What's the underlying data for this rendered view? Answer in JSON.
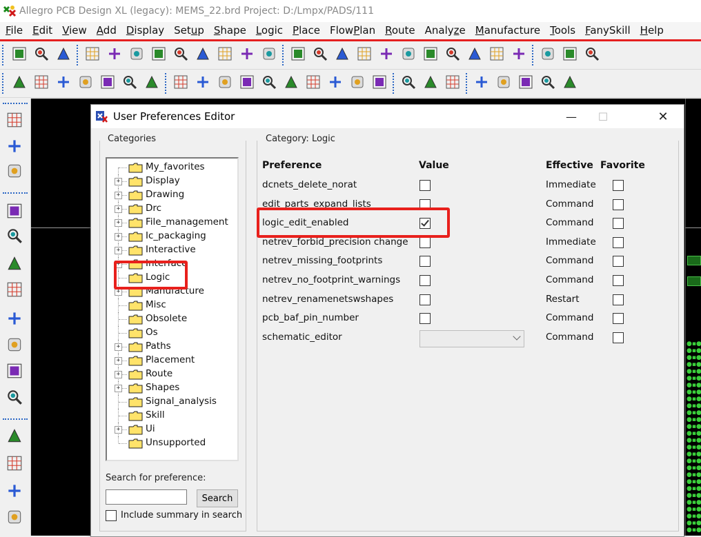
{
  "window": {
    "title": "Allegro PCB Design XL (legacy): MEMS_22.brd  Project: D:/Lmpx/PADS/111"
  },
  "menu": [
    {
      "label": "File",
      "ul": "F",
      "rest": "ile"
    },
    {
      "label": "Edit",
      "ul": "E",
      "rest": "dit"
    },
    {
      "label": "View",
      "ul": "V",
      "rest": "iew"
    },
    {
      "label": "Add",
      "ul": "A",
      "rest": "dd"
    },
    {
      "label": "Display",
      "ul": "D",
      "rest": "isplay"
    },
    {
      "label": "Setup",
      "pre": "Set",
      "ul": "u",
      "rest": "p"
    },
    {
      "label": "Shape",
      "ul": "S",
      "rest": "hape"
    },
    {
      "label": "Logic",
      "ul": "L",
      "rest": "ogic"
    },
    {
      "label": "Place",
      "ul": "P",
      "rest": "lace"
    },
    {
      "label": "FlowPlan",
      "pre": "Flow",
      "ul": "P",
      "rest": "lan"
    },
    {
      "label": "Route",
      "ul": "R",
      "rest": "oute"
    },
    {
      "label": "Analyze",
      "pre": "Analy",
      "ul": "z",
      "rest": "e"
    },
    {
      "label": "Manufacture",
      "ul": "M",
      "rest": "anufacture"
    },
    {
      "label": "Tools",
      "ul": "T",
      "rest": "ools"
    },
    {
      "label": "FanySkill",
      "ul": "F",
      "rest": "anySkill"
    },
    {
      "label": "Help",
      "ul": "H",
      "rest": "elp"
    }
  ],
  "dialog": {
    "title": "User Preferences Editor",
    "categories_label": "Categories",
    "category_label": "Category:  Logic",
    "search_label": "Search for preference:",
    "search_value": "",
    "search_button": "Search",
    "include_summary_label": "Include summary in search",
    "include_summary_checked": false,
    "tree": [
      {
        "label": "My_favorites",
        "expandable": false
      },
      {
        "label": "Display",
        "expandable": true
      },
      {
        "label": "Drawing",
        "expandable": true
      },
      {
        "label": "Drc",
        "expandable": true
      },
      {
        "label": "File_management",
        "expandable": true
      },
      {
        "label": "Ic_packaging",
        "expandable": true
      },
      {
        "label": "Interactive",
        "expandable": true
      },
      {
        "label": "Interface",
        "expandable": true
      },
      {
        "label": "Logic",
        "expandable": false,
        "selected": true
      },
      {
        "label": "Manufacture",
        "expandable": true
      },
      {
        "label": "Misc",
        "expandable": false
      },
      {
        "label": "Obsolete",
        "expandable": false
      },
      {
        "label": "Os",
        "expandable": false
      },
      {
        "label": "Paths",
        "expandable": true
      },
      {
        "label": "Placement",
        "expandable": true
      },
      {
        "label": "Route",
        "expandable": true
      },
      {
        "label": "Shapes",
        "expandable": true
      },
      {
        "label": "Signal_analysis",
        "expandable": false
      },
      {
        "label": "Skill",
        "expandable": false
      },
      {
        "label": "Ui",
        "expandable": true
      },
      {
        "label": "Unsupported",
        "expandable": false
      }
    ],
    "columns": {
      "preference": "Preference",
      "value": "Value",
      "effective": "Effective",
      "favorite": "Favorite"
    },
    "preferences": [
      {
        "name": "dcnets_delete_norat",
        "type": "check",
        "checked": false,
        "effective": "Immediate",
        "favorite": false
      },
      {
        "name": "edit_parts_expand_lists",
        "type": "check",
        "checked": false,
        "effective": "Command",
        "favorite": false
      },
      {
        "name": "logic_edit_enabled",
        "type": "check",
        "checked": true,
        "effective": "Command",
        "favorite": false
      },
      {
        "name": "netrev_forbid_precision change",
        "type": "check",
        "checked": false,
        "effective": "Immediate",
        "favorite": false
      },
      {
        "name": "netrev_missing_footprints",
        "type": "check",
        "checked": false,
        "effective": "Command",
        "favorite": false
      },
      {
        "name": "netrev_no_footprint_warnings",
        "type": "check",
        "checked": false,
        "effective": "Command",
        "favorite": false
      },
      {
        "name": "netrev_renamenetswshapes",
        "type": "check",
        "checked": false,
        "effective": "Restart",
        "favorite": false
      },
      {
        "name": "pcb_baf_pin_number",
        "type": "check",
        "checked": false,
        "effective": "Command",
        "favorite": false
      },
      {
        "name": "schematic_editor",
        "type": "select",
        "value": "",
        "effective": "Command",
        "favorite": false
      }
    ]
  },
  "toolbar1_icons": [
    "new-file",
    "open-folder",
    "save",
    "move",
    "copy",
    "delete",
    "undo",
    "undo-down",
    "redo",
    "redo-down",
    "green-blob",
    "pin",
    "grid-snap",
    "grid-select",
    "zoom-fit",
    "zoom-area",
    "zoom-in",
    "zoom-out",
    "zoom-prev",
    "zoom-world",
    "refresh",
    "3d",
    "flip",
    "grid",
    "color",
    "layers"
  ],
  "toolbar2_icons": [
    "place-green",
    "place-green2",
    "place-green3",
    "place-green4",
    "place-green5",
    "place-gray",
    "place-gray2",
    "shape-corner",
    "shape-rect",
    "shape-circle",
    "select-arrow",
    "shape-frame",
    "shape-round",
    "shape-square",
    "shape-round2",
    "shape-poly",
    "merge",
    "component",
    "dimension",
    "dimension2",
    "odb",
    "cross-section",
    "skill",
    "camera",
    "settings"
  ],
  "left_icons": [
    "layer-stack",
    "u1-component",
    "swap",
    "add-connect",
    "slide",
    "route-delay",
    "fanout",
    "route-arrows",
    "bus",
    "pattern-grid",
    "tune",
    "line",
    "rectangle",
    "abc-add",
    "abc-edit"
  ]
}
